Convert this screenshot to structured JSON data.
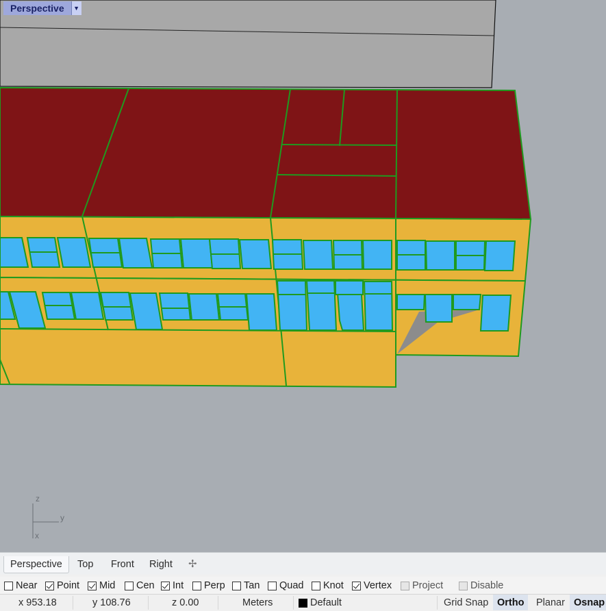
{
  "viewport": {
    "title": "Perspective",
    "axes": {
      "z": "z",
      "y": "y",
      "x": "x"
    }
  },
  "colors": {
    "background": "#a8adb3",
    "roof": "#7f1416",
    "wall": "#e8b33a",
    "window": "#42b4f4",
    "edge": "#1f9a1f",
    "upper_block": "#a8a8a8",
    "shadow": "#888888",
    "viewport_label": "#9ea8dc"
  },
  "tabs": [
    {
      "label": "Perspective",
      "active": true
    },
    {
      "label": "Top",
      "active": false
    },
    {
      "label": "Front",
      "active": false
    },
    {
      "label": "Right",
      "active": false
    }
  ],
  "add_tab_icon": "plus-icon",
  "osnaps": [
    {
      "label": "Near",
      "checked": false,
      "enabled": true
    },
    {
      "label": "Point",
      "checked": true,
      "enabled": true
    },
    {
      "label": "Mid",
      "checked": true,
      "enabled": true
    },
    {
      "label": "Cen",
      "checked": false,
      "enabled": true
    },
    {
      "label": "Int",
      "checked": true,
      "enabled": true
    },
    {
      "label": "Perp",
      "checked": false,
      "enabled": true
    },
    {
      "label": "Tan",
      "checked": false,
      "enabled": true
    },
    {
      "label": "Quad",
      "checked": false,
      "enabled": true
    },
    {
      "label": "Knot",
      "checked": false,
      "enabled": true
    },
    {
      "label": "Vertex",
      "checked": true,
      "enabled": true
    },
    {
      "label": "Project",
      "checked": false,
      "enabled": false
    },
    {
      "label": "Disable",
      "checked": false,
      "enabled": false
    }
  ],
  "status": {
    "x": "x 953.18",
    "y": "y 108.76",
    "z": "z 0.00",
    "units": "Meters",
    "layer": "Default",
    "layer_color": "#000000",
    "grid_snap": "Grid Snap",
    "ortho": "Ortho",
    "planar": "Planar",
    "osnap": "Osnap"
  }
}
